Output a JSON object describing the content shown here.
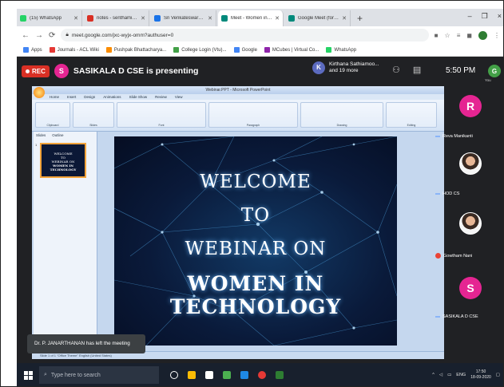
{
  "browser": {
    "tabs": [
      {
        "label": "(15) WhatsApp",
        "favicon_color": "#25d366",
        "active": false
      },
      {
        "label": "notes - senthamizhsarvalli@...",
        "favicon_color": "#d93025",
        "active": false
      },
      {
        "label": "Sri Venkateswara College of E...",
        "favicon_color": "#1a73e8",
        "active": false
      },
      {
        "label": "Meet - Women in Technol...",
        "favicon_color": "#00897b",
        "active": true
      },
      {
        "label": "Google Meet (formerly Hang...",
        "favicon_color": "#00897b",
        "active": false
      }
    ],
    "new_tab": "+",
    "window_controls": [
      "–",
      "❐",
      "×"
    ],
    "url": "meet.google.com/jxc-wyjx-omm?authuser=0",
    "bookmarks": [
      {
        "label": "Apps",
        "color": "#4285f4"
      },
      {
        "label": "Journals - ACL Wiki",
        "color": "#e53935"
      },
      {
        "label": "Pushpak Bhattacharya...",
        "color": "#fb8c00"
      },
      {
        "label": "College Login (Vtu)...",
        "color": "#43a047"
      },
      {
        "label": "Google",
        "color": "#4285f4"
      },
      {
        "label": "MCubes | Virtual Co...",
        "color": "#8e24aa"
      },
      {
        "label": "WhatsApp",
        "color": "#25d366"
      }
    ]
  },
  "meet": {
    "rec_label": "REC",
    "presenter_initial": "S",
    "presenter_text": "SASIKALA D CSE is presenting",
    "people_initial": "K",
    "people_line1": "Kirthana Sathiamoo...",
    "people_line2": "and 19 more",
    "time": "5:50 PM",
    "you_label": "You",
    "self_initial": "G",
    "toast": "Dr. P. JANARTHANAN has left the meeting",
    "participants": [
      {
        "name": "Reva Manikanti",
        "initial": "R",
        "color": "#e52592",
        "type": "letter",
        "mic": "on"
      },
      {
        "name": "HOD CS",
        "initial": "",
        "color": "",
        "type": "photo",
        "mic": "on"
      },
      {
        "name": "Gowtham Nani",
        "initial": "",
        "color": "",
        "type": "photo",
        "mic": "off"
      },
      {
        "name": "SASIKALA D CSE",
        "initial": "S",
        "color": "#e52592",
        "type": "letter",
        "mic": "on"
      }
    ]
  },
  "ppt": {
    "window_title": "Webinar.PPT - Microsoft PowerPoint",
    "ribbon_tabs": [
      "Home",
      "Insert",
      "Design",
      "Animations",
      "Slide Show",
      "Review",
      "View"
    ],
    "ribbon_groups": [
      "Clipboard",
      "Slides",
      "Font",
      "Paragraph",
      "Drawing",
      "Editing"
    ],
    "pane_tabs": [
      "Slides",
      "Outline"
    ],
    "thumb_number": "1",
    "thumb_lines": [
      "WELCOME",
      "TO",
      "WEBINAR ON",
      "WOMEN IN TECHNOLOGY"
    ],
    "slide_lines": [
      "WELCOME",
      "TO",
      "WEBINAR ON",
      "WOMEN  IN TECHNOLOGY"
    ],
    "status_text": "Slide 1 of 1   \"Office Theme\"   English (United States)"
  },
  "taskbar": {
    "search_placeholder": "Type here to search",
    "pinned_colors": [
      "#ffffff",
      "#fbbc05",
      "#ffffff",
      "#4caf50",
      "#1e88e5",
      "#e53935",
      "#2e7d32"
    ],
    "tray_lang": "ENG",
    "clock_time": "17:50",
    "clock_date": "18-09-2020"
  }
}
